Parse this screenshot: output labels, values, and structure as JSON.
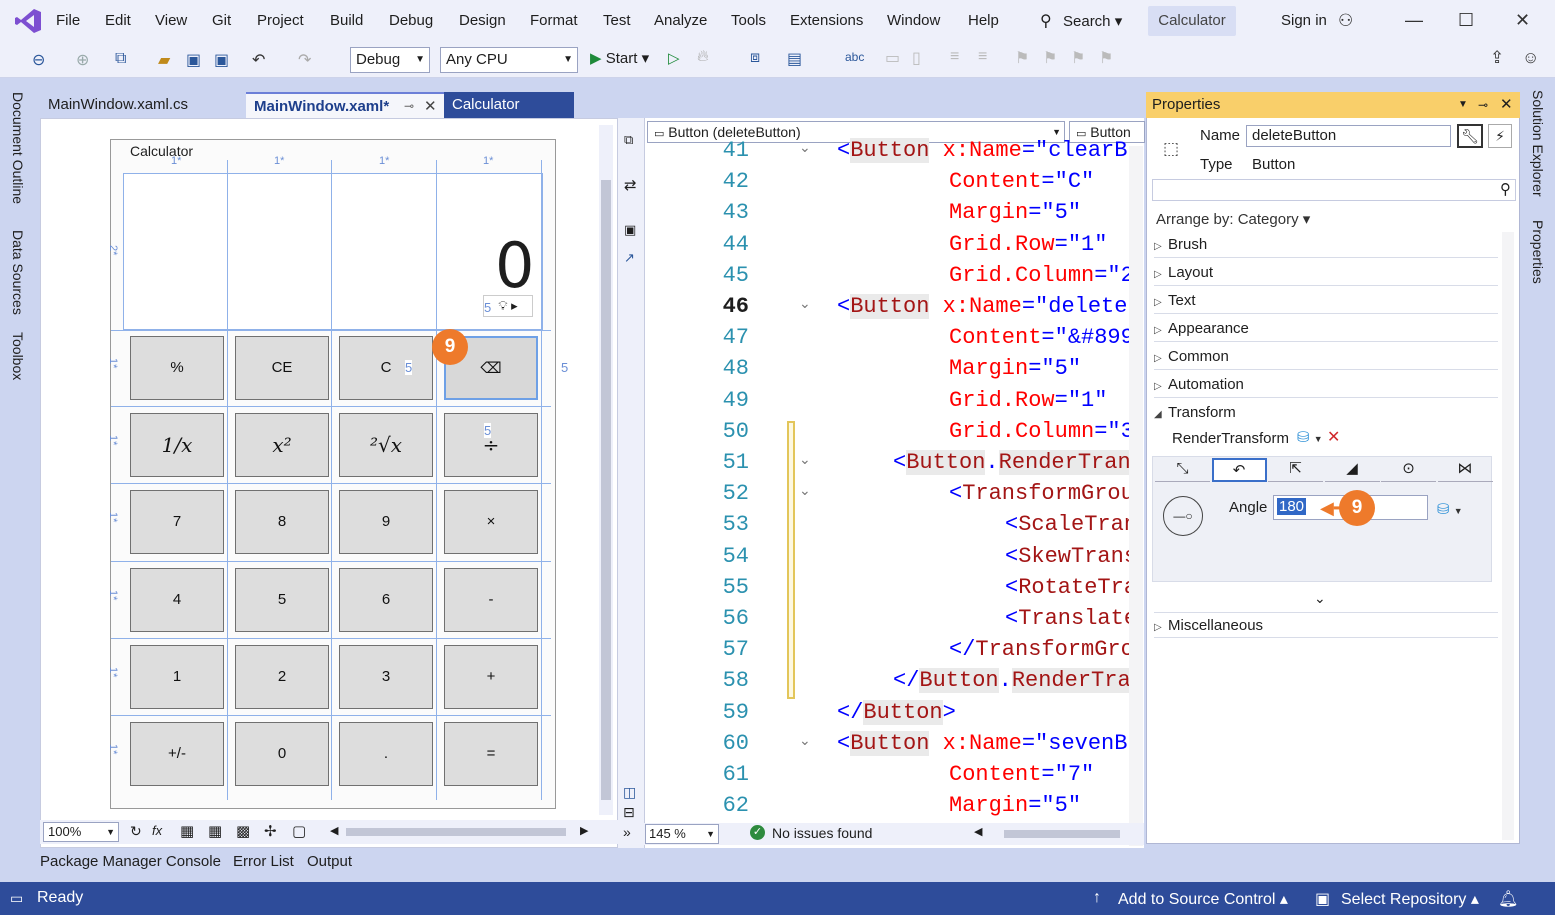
{
  "menubar": {
    "items": [
      "File",
      "Edit",
      "View",
      "Git",
      "Project",
      "Build",
      "Debug",
      "Design",
      "Format",
      "Test",
      "Analyze",
      "Tools",
      "Extensions",
      "Window",
      "Help"
    ],
    "search_label": "Search",
    "solution_badge": "Calculator",
    "sign_in": "Sign in"
  },
  "toolbar": {
    "config": "Debug",
    "platform": "Any CPU",
    "start_label": "Start"
  },
  "left_rail": [
    "Document Outline",
    "Data Sources",
    "Toolbox"
  ],
  "right_rail": [
    "Solution Explorer",
    "Properties"
  ],
  "doc_tabs": [
    {
      "label": "MainWindow.xaml.cs",
      "active": false
    },
    {
      "label": "MainWindow.xaml*",
      "active": true
    },
    {
      "label": "Calculator",
      "active": false
    }
  ],
  "designer": {
    "window_title": "Calculator",
    "display_value": "0",
    "col_labels": [
      "1*",
      "1*",
      "1*",
      "1*"
    ],
    "row_labels": [
      "2*",
      "1*",
      "1*",
      "1*",
      "1*",
      "1*",
      "1*"
    ],
    "margin_labels": [
      "5",
      "5",
      "5",
      "5"
    ],
    "buttons": [
      [
        "%",
        "CE",
        "C",
        "⌫"
      ],
      [
        "1/x",
        "x²",
        "²√x",
        "÷"
      ],
      [
        "7",
        "8",
        "9",
        "×"
      ],
      [
        "4",
        "5",
        "6",
        "-"
      ],
      [
        "1",
        "2",
        "3",
        "+"
      ],
      [
        "+/-",
        "0",
        ".",
        "="
      ]
    ],
    "zoom": "100%",
    "marker": "9"
  },
  "code": {
    "element_combo": "Button (deleteButton)",
    "member_combo": "Button",
    "lines": [
      {
        "n": "41",
        "indent": 0,
        "parts": [
          [
            "br",
            "<"
          ],
          [
            "tag",
            "Button"
          ],
          [
            "attr",
            " x:Name"
          ],
          [
            "br",
            "=\""
          ],
          [
            "val",
            "clearB"
          ]
        ]
      },
      {
        "n": "42",
        "indent": 2,
        "parts": [
          [
            "attr",
            "Content"
          ],
          [
            "br",
            "=\""
          ],
          [
            "val",
            "C"
          ],
          [
            "br",
            "\""
          ]
        ]
      },
      {
        "n": "43",
        "indent": 2,
        "parts": [
          [
            "attr",
            "Margin"
          ],
          [
            "br",
            "=\""
          ],
          [
            "val",
            "5"
          ],
          [
            "br",
            "\""
          ]
        ]
      },
      {
        "n": "44",
        "indent": 2,
        "parts": [
          [
            "attr",
            "Grid.Row"
          ],
          [
            "br",
            "=\""
          ],
          [
            "val",
            "1"
          ],
          [
            "br",
            "\""
          ]
        ]
      },
      {
        "n": "45",
        "indent": 2,
        "parts": [
          [
            "attr",
            "Grid.Column"
          ],
          [
            "br",
            "=\""
          ],
          [
            "val",
            "2"
          ]
        ]
      },
      {
        "n": "46",
        "indent": 0,
        "parts": [
          [
            "br",
            "<"
          ],
          [
            "tag",
            "Button"
          ],
          [
            "attr",
            " x:Name"
          ],
          [
            "br",
            "=\""
          ],
          [
            "val",
            "delete"
          ]
        ]
      },
      {
        "n": "47",
        "indent": 2,
        "parts": [
          [
            "attr",
            "Content"
          ],
          [
            "br",
            "=\""
          ],
          [
            "val",
            "&#899"
          ]
        ]
      },
      {
        "n": "48",
        "indent": 2,
        "parts": [
          [
            "attr",
            "Margin"
          ],
          [
            "br",
            "=\""
          ],
          [
            "val",
            "5"
          ],
          [
            "br",
            "\""
          ]
        ]
      },
      {
        "n": "49",
        "indent": 2,
        "parts": [
          [
            "attr",
            "Grid.Row"
          ],
          [
            "br",
            "=\""
          ],
          [
            "val",
            "1"
          ],
          [
            "br",
            "\""
          ]
        ]
      },
      {
        "n": "50",
        "indent": 2,
        "parts": [
          [
            "attr",
            "Grid.Column"
          ],
          [
            "br",
            "=\""
          ],
          [
            "val",
            "3"
          ]
        ]
      },
      {
        "n": "51",
        "indent": 1,
        "parts": [
          [
            "br",
            "<"
          ],
          [
            "tag",
            "Button"
          ],
          [
            "br",
            "."
          ],
          [
            "tag",
            "RenderTran"
          ]
        ]
      },
      {
        "n": "52",
        "indent": 2,
        "parts": [
          [
            "br",
            "<"
          ],
          [
            "tag",
            "TransformGrou"
          ]
        ]
      },
      {
        "n": "53",
        "indent": 3,
        "parts": [
          [
            "br",
            "<"
          ],
          [
            "tag",
            "ScaleTran"
          ]
        ]
      },
      {
        "n": "54",
        "indent": 3,
        "parts": [
          [
            "br",
            "<"
          ],
          [
            "tag",
            "SkewTrans"
          ]
        ]
      },
      {
        "n": "55",
        "indent": 3,
        "parts": [
          [
            "br",
            "<"
          ],
          [
            "tag",
            "RotateTra"
          ]
        ]
      },
      {
        "n": "56",
        "indent": 3,
        "parts": [
          [
            "br",
            "<"
          ],
          [
            "tag",
            "Translate"
          ]
        ]
      },
      {
        "n": "57",
        "indent": 2,
        "parts": [
          [
            "br",
            "</"
          ],
          [
            "tag",
            "TransformGro"
          ]
        ]
      },
      {
        "n": "58",
        "indent": 1,
        "parts": [
          [
            "br",
            "</"
          ],
          [
            "tag",
            "Button"
          ],
          [
            "br",
            "."
          ],
          [
            "tag",
            "RenderTra"
          ]
        ]
      },
      {
        "n": "59",
        "indent": 0,
        "parts": [
          [
            "br",
            "</"
          ],
          [
            "tag",
            "Button"
          ],
          [
            "br",
            ">"
          ]
        ]
      },
      {
        "n": "60",
        "indent": 0,
        "parts": [
          [
            "br",
            "<"
          ],
          [
            "tag",
            "Button"
          ],
          [
            "attr",
            " x:Name"
          ],
          [
            "br",
            "=\""
          ],
          [
            "val",
            "sevenB"
          ]
        ]
      },
      {
        "n": "61",
        "indent": 2,
        "parts": [
          [
            "attr",
            "Content"
          ],
          [
            "br",
            "=\""
          ],
          [
            "val",
            "7"
          ],
          [
            "br",
            "\""
          ]
        ]
      },
      {
        "n": "62",
        "indent": 2,
        "parts": [
          [
            "attr",
            "Margin"
          ],
          [
            "br",
            "=\""
          ],
          [
            "val",
            "5"
          ],
          [
            "br",
            "\""
          ]
        ]
      }
    ],
    "zoom": "145 %",
    "status": "No issues found"
  },
  "properties": {
    "title": "Properties",
    "name_label": "Name",
    "name_value": "deleteButton",
    "type_label": "Type",
    "type_value": "Button",
    "arrange_by": "Arrange by: Category",
    "categories": [
      "Brush",
      "Layout",
      "Text",
      "Appearance",
      "Common",
      "Automation"
    ],
    "transform_label": "Transform",
    "render_transform_label": "RenderTransform",
    "angle_label": "Angle",
    "angle_value": "180",
    "misc_label": "Miscellaneous",
    "marker": "9"
  },
  "bottom_tabs": [
    "Package Manager Console",
    "Error List",
    "Output"
  ],
  "status": {
    "ready": "Ready",
    "source_control": "Add to Source Control",
    "repository": "Select Repository"
  },
  "colors": {
    "accent": "#2e4c9a",
    "marker": "#ee7a2b",
    "properties_header": "#f9cf6a"
  }
}
